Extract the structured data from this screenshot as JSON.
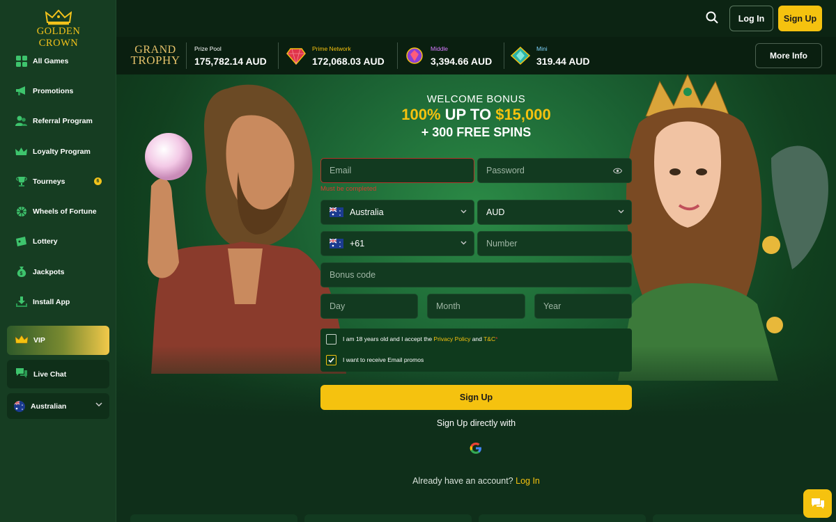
{
  "brand": {
    "name": "GOLDEN CROWN"
  },
  "sidebar": {
    "items": [
      {
        "label": "All Games",
        "icon": "grid-icon"
      },
      {
        "label": "Promotions",
        "icon": "megaphone-icon"
      },
      {
        "label": "Referral Program",
        "icon": "users-icon"
      },
      {
        "label": "Loyalty Program",
        "icon": "crown-icon"
      },
      {
        "label": "Tourneys",
        "icon": "trophy-icon",
        "badge": "6"
      },
      {
        "label": "Wheels of Fortune",
        "icon": "wheel-icon"
      },
      {
        "label": "Lottery",
        "icon": "ticket-icon"
      },
      {
        "label": "Jackpots",
        "icon": "money-bag-icon"
      },
      {
        "label": "Install App",
        "icon": "download-icon"
      }
    ],
    "vip": "VIP",
    "live_chat": "Live Chat",
    "language": "Australian"
  },
  "header": {
    "login": "Log In",
    "signup": "Sign Up"
  },
  "jackpots": {
    "logo_line1": "GRAND",
    "logo_line2": "TROPHY",
    "items": [
      {
        "title": "Prize Pool",
        "value": "175,782.14 AUD",
        "color": "#ffffff"
      },
      {
        "title": "Prime Network",
        "value": "172,068.03 AUD",
        "color": "#f5c20f"
      },
      {
        "title": "Middle",
        "value": "3,394.66 AUD",
        "color": "#d67bff"
      },
      {
        "title": "Mini",
        "value": "319.44 AUD",
        "color": "#7fd6ff"
      }
    ],
    "more_info": "More Info"
  },
  "hero": {
    "line1": "WELCOME BONUS",
    "line2_a": "100%",
    "line2_b": " UP TO ",
    "line2_c": "$15,000",
    "line3": "+ 300 FREE SPINS"
  },
  "form": {
    "email_placeholder": "Email",
    "email_error": "Must be completed",
    "password_placeholder": "Password",
    "country": "Australia",
    "currency": "AUD",
    "phone_code": "+61",
    "number_placeholder": "Number",
    "bonus_placeholder": "Bonus code",
    "day_placeholder": "Day",
    "month_placeholder": "Month",
    "year_placeholder": "Year",
    "terms_a": "I am 18 years old and I accept the ",
    "terms_privacy": "Privacy Policy",
    "terms_and": " and ",
    "terms_tc": "T&C",
    "terms_star": "*",
    "promo_text": "I want to receive Email promos",
    "promo_checked": true,
    "terms_checked": false,
    "submit": "Sign Up",
    "direct": "Sign Up directly with",
    "already": "Already have an account?",
    "login_link": "Log In"
  }
}
